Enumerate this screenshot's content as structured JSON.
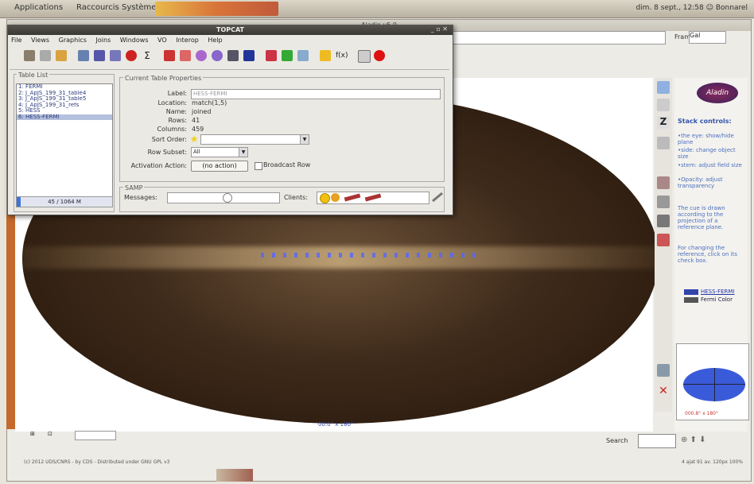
{
  "system_panel": {
    "menus": [
      "Applications",
      "Raccourcis",
      "Système"
    ],
    "clock": "dim. 8 sept., 12:58  ☺ Bonnarel"
  },
  "aladin": {
    "title": "Aladin v5.9",
    "frame_label": "Frame",
    "frame_value": "Gal",
    "sky_coord_label": "00.0° x 180°",
    "stack_title": "Stack controls:",
    "help_lines": [
      "•the eye: show/hide plane",
      "•side: change object size",
      "•stem: adjust field size",
      "•Opacity: adjust transparency",
      "The cue is drawn according to the projection of a reference plane.",
      "For changing the reference, click on its check box."
    ],
    "stack_items": [
      "HESS-FERMI",
      "Fermi Color"
    ],
    "mini_view_label": "000.8° x 180°",
    "search_label": "Search",
    "status_text": "(c) 2012 UDS/CNRS - by CDS - Distributed under GNU GPL v3",
    "status_right": "4 ajat 91 av.  120px 100%"
  },
  "topcat": {
    "title": "TOPCAT",
    "menu": [
      "File",
      "Views",
      "Graphics",
      "Joins",
      "Windows",
      "VO",
      "Interop",
      "Help"
    ],
    "table_list": {
      "title": "Table List",
      "items": [
        "1: FERMI",
        "2: J_ApJS_199_31_table4",
        "3: J_ApJS_199_31_table5",
        "4: J_ApJS_199_31_refs",
        "5: HESS",
        "6: HESS-FERMI"
      ],
      "selected_index": 5,
      "memory": "45 / 1064 M",
      "memory_fraction": 0.04
    },
    "properties": {
      "title": "Current Table Properties",
      "label_label": "Label:",
      "label_value": "HESS-FERMI",
      "location_label": "Location:",
      "location_value": "match(1,5)",
      "name_label": "Name:",
      "name_value": "joined",
      "rows_label": "Rows:",
      "rows_value": "41",
      "columns_label": "Columns:",
      "columns_value": "459",
      "sort_label": "Sort Order:",
      "subset_label": "Row Subset:",
      "subset_value": "All",
      "activation_label": "Activation Action:",
      "activation_button": "(no action)",
      "broadcast_label": "Broadcast Row"
    },
    "samp": {
      "title": "SAMP",
      "messages_label": "Messages:",
      "clients_label": "Clients:"
    }
  }
}
